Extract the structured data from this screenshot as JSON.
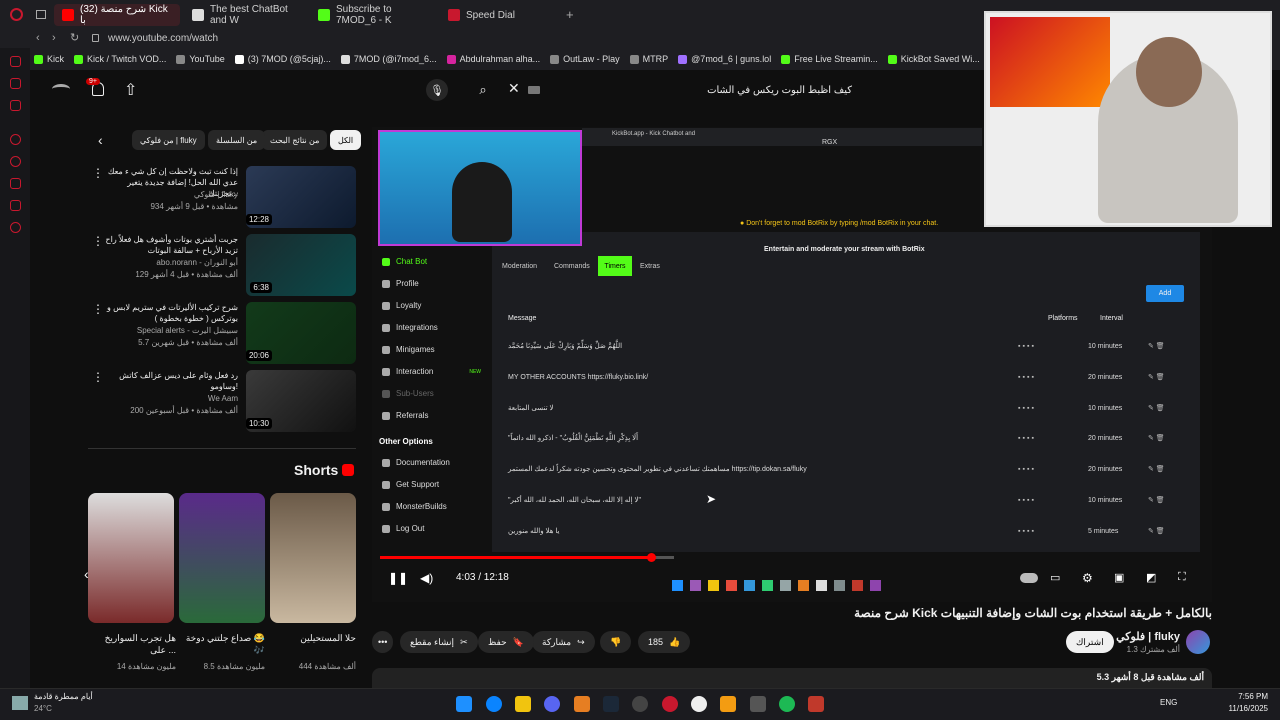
{
  "tabs": [
    {
      "label": "(32) شرح منصة Kick با",
      "active": true
    },
    {
      "label": "The best ChatBot and W"
    },
    {
      "label": "Subscribe to 7MOD_6 - K"
    },
    {
      "label": "Speed Dial"
    }
  ],
  "url": "www.youtube.com/watch",
  "bookmarks": [
    "Kick",
    "Kick / Twitch VOD...",
    "YouTube",
    "(3) 7MOD (@5cjaj)...",
    "7MOD (@i7mod_6...",
    "Abdulrahman alha...",
    "OutLaw - Play",
    "MTRP",
    "@7mod_6 | guns.lol",
    "Free Live Streamin...",
    "KickBot Saved Wi..."
  ],
  "header": {
    "search_query": "كيف اظبط البوت ريكس في الشات",
    "notif_count": "9+"
  },
  "chips": [
    "الكل",
    "من نتائج البحث",
    "من السلسلة",
    "من فلوكي | fluky"
  ],
  "recommendations": [
    {
      "title": "إذا كنت تبث ولاحظت إن كل شي ء معك عدي الله الحل! إضافة جديدة يتغير تجربتك...",
      "channel": "فلوكي | fluky",
      "meta": "934 مشاهدة • قبل 9 أشهر",
      "duration": "12:28"
    },
    {
      "title": "جربت أشتري بوتات وأشوف هل فعلاً راح تزيد الأرباح + سالفة البوتات",
      "channel": "abo.norann - أبو النوران",
      "meta": "129 ألف مشاهدة • قبل 4 أشهر",
      "duration": "6:38"
    },
    {
      "title": "شرح تركيب الأليرتات في ستريم لابس و بوتركس ( خطوة بخطوة )",
      "channel": "Special alerts - سبيشل اليرت",
      "meta": "5.7 ألف مشاهدة • قبل شهرين",
      "duration": "20:06"
    },
    {
      "title": "رد فعل وئام على ديس عزالف كاتش وساومو!",
      "channel": "We Aam",
      "meta": "200 ألف مشاهدة • قبل أسبوعين",
      "duration": "10:30"
    }
  ],
  "shorts": {
    "heading": "Shorts",
    "items": [
      {
        "title": "حلا المستحيلين",
        "views": "444 ألف مشاهدة"
      },
      {
        "title": "صداع جلتني دوخة 😂🎶",
        "views": "8.5 مليون مشاهدة"
      },
      {
        "title": "هل تجرب السواريخ على ...",
        "views": "14 مليون مشاهدة"
      }
    ]
  },
  "botapp": {
    "tab_title": "KickBot.app - Kick Chatbot and",
    "notice": "Don't forget to mod BotRix by typing /mod BotRix in your chat.",
    "heading": "Entertain and moderate your stream with BotRix",
    "sidebar": [
      "Chat Bot",
      "Profile",
      "Loyalty",
      "Integrations",
      "Minigames",
      "Interaction",
      "Sub-Users",
      "Referrals",
      "Other Options",
      "Documentation",
      "Get Support",
      "MonsterBuilds",
      "Log Out"
    ],
    "new_badge": "NEW",
    "tabs": [
      "Moderation",
      "Commands",
      "Timers",
      "Extras"
    ],
    "add_label": "Add",
    "columns": [
      "Message",
      "Platforms",
      "Interval"
    ],
    "rows": [
      {
        "message": "اللَّهُمَّ صَلِّ وَسَلِّمْ وَبَارِكْ عَلَى سَيِّدِنَا مُحَمَّد",
        "interval": "10 minutes"
      },
      {
        "message": "MY OTHER ACCOUNTS https://fluky.bio.link/",
        "interval": "20 minutes"
      },
      {
        "message": "لا تنسى المتابعة",
        "interval": "10 minutes"
      },
      {
        "message": "\"أَلَا بِذِكْرِ اللَّهِ تَطْمَئِنُّ الْقُلُوبُ\" - اذكرو الله دائماً",
        "interval": "20 minutes"
      },
      {
        "message": "مساهمتك تساعدني في تطوير المحتوى وتحسين جودته شكراً لدعمك المستمر https://tip.dokan.sa/fluky",
        "interval": "20 minutes"
      },
      {
        "message": "\"لا إله إلا الله، سبحان الله، الحمد لله، الله أكبر\"",
        "interval": "10 minutes"
      },
      {
        "message": "يا هلا والله منورين",
        "interval": "5 minutes"
      }
    ]
  },
  "player": {
    "time": "4:03 / 12:18",
    "progress_fraction": 0.32
  },
  "video": {
    "title": "شرح منصة Kick بالكامل + طريقة استخدام بوت الشات وإضافة التنبيهات",
    "channel": "فلوكي | fluky",
    "subs": "1.3 ألف مشترك",
    "subscribe": "اشتراك",
    "likes": "185",
    "share": "مشاركة",
    "save": "حفظ",
    "clip": "إنشاء مقطع",
    "views": "5.3 ألف مشاهدة قبل 8 أشهر"
  },
  "taskbar": {
    "weather": "أيام ممطرة قادمة",
    "temp": "24°C",
    "lang": "ENG",
    "time": "7:56 PM",
    "date": "11/16/2025"
  }
}
